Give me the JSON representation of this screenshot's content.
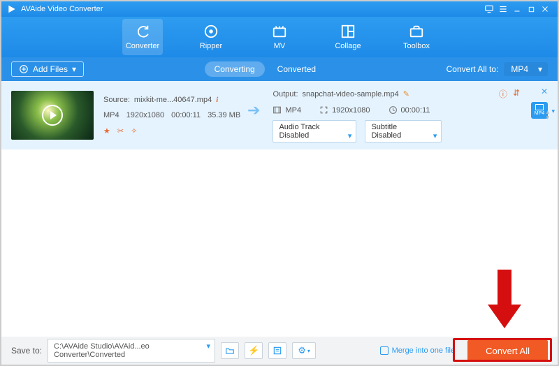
{
  "app": {
    "title": "AVAide Video Converter"
  },
  "nav": {
    "items": [
      {
        "label": "Converter"
      },
      {
        "label": "Ripper"
      },
      {
        "label": "MV"
      },
      {
        "label": "Collage"
      },
      {
        "label": "Toolbox"
      }
    ]
  },
  "subbar": {
    "add_files": "Add Files",
    "tabs": [
      {
        "label": "Converting"
      },
      {
        "label": "Converted"
      }
    ],
    "convert_all_to_label": "Convert All to:",
    "convert_all_to_value": "MP4"
  },
  "file": {
    "source_label": "Source:",
    "source_name": "mixkit-me...40647.mp4",
    "src_format": "MP4",
    "src_resolution": "1920x1080",
    "src_duration": "00:00:11",
    "src_size": "35.39 MB",
    "output_label": "Output:",
    "output_name": "snapchat-video-sample.mp4",
    "out_format": "MP4",
    "out_resolution": "1920x1080",
    "out_duration": "00:00:11",
    "audio_select": "Audio Track Disabled",
    "subtitle_select": "Subtitle Disabled",
    "fmt_badge": "MP4"
  },
  "bottom": {
    "save_to_label": "Save to:",
    "save_path": "C:\\AVAide Studio\\AVAid...eo Converter\\Converted",
    "merge_label": "Merge into one file",
    "convert_all_btn": "Convert All"
  }
}
